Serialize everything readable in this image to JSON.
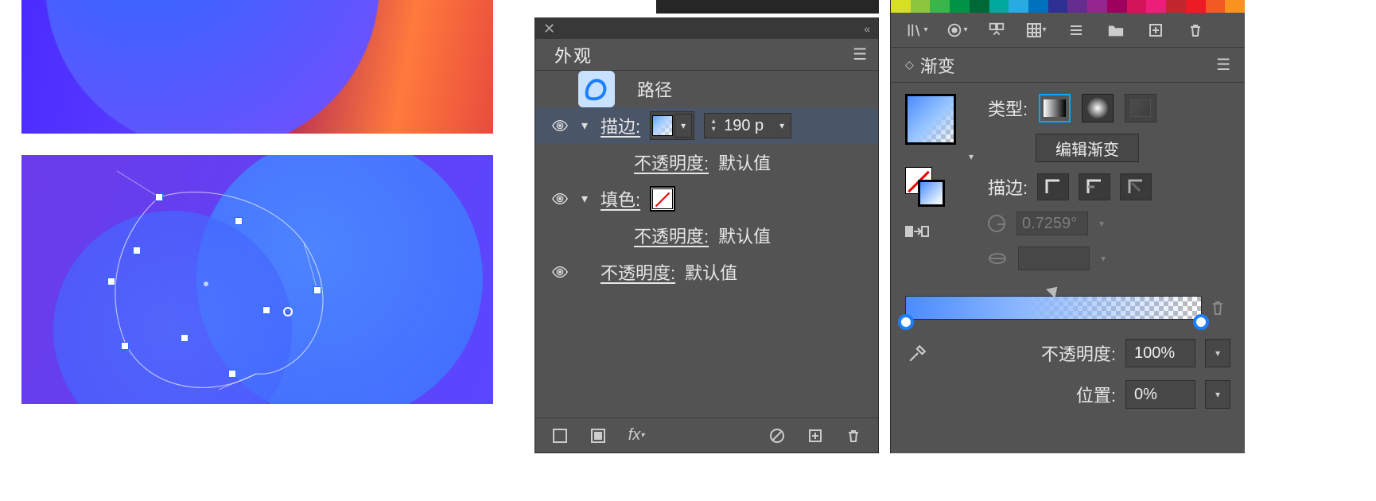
{
  "appearance_panel": {
    "title": "外观",
    "path_label": "路径",
    "rows": {
      "stroke_label": "描边:",
      "stroke_width_value": "190 p",
      "opacity_label": "不透明度:",
      "opacity_default": "默认值",
      "fill_label": "填色:"
    },
    "footer_icons": [
      "no-fill",
      "solid-fill",
      "fx",
      "blocked",
      "new",
      "delete"
    ]
  },
  "gradient_panel": {
    "title": "渐变",
    "type_label": "类型:",
    "edit_gradient_label": "编辑渐变",
    "stroke_label": "描边:",
    "angle_value": "0.7259°",
    "aspect_value": "",
    "opacity_label": "不透明度:",
    "opacity_value": "100%",
    "location_label": "位置:",
    "location_value": "0%"
  },
  "swatch_colors": [
    "#d7df23",
    "#8a6e2f",
    "#1a1a1a",
    "#1f9ed1",
    "#1471b8",
    "#205aa7",
    "#372a7c",
    "#6a2a8b",
    "#b5187f",
    "#1b9e4b",
    "#107a3a",
    "#0a5c2e",
    "#59179e",
    "#00a99d",
    "#231f20",
    "#ed1c24",
    "#c1272d",
    "#f7931e"
  ],
  "toolbar_icons": [
    "library",
    "target",
    "swap",
    "grid",
    "list",
    "folder",
    "new",
    "trash"
  ]
}
